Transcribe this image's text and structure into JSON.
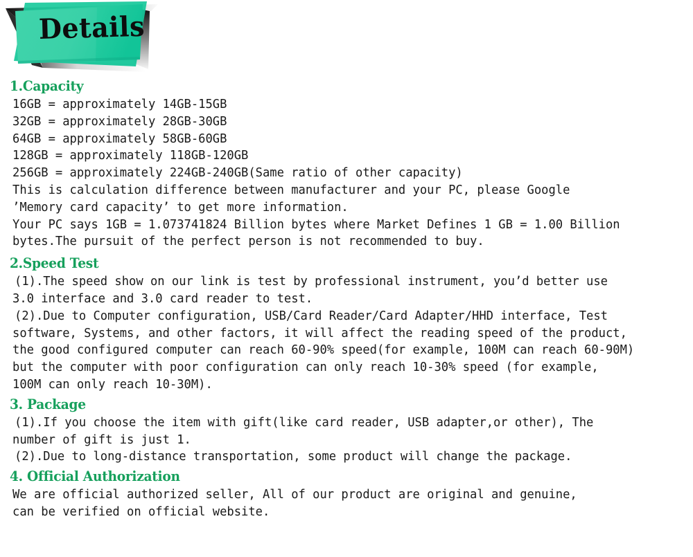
{
  "banner": {
    "title": "Details",
    "colors": {
      "accent_green": "#2ecfa4",
      "accent_green_dark": "#14c79b",
      "shadow_dark": "#111111",
      "title_color": "#0d0d0d"
    }
  },
  "theme": {
    "heading_green": "#16a05c",
    "body_text": "#1a1a1a",
    "background": "#ffffff"
  },
  "sections": [
    {
      "id": "capacity",
      "heading": "1.Capacity",
      "lines": [
        "16GB = approximately 14GB-15GB",
        "32GB = approximately 28GB-30GB",
        "64GB = approximately 58GB-60GB",
        "128GB = approximately 118GB-120GB",
        "256GB = approximately 224GB-240GB(Same ratio of other capacity)",
        "This is calculation difference between manufacturer and your PC, please Google",
        "’Memory card capacity’ to get more information.",
        "Your PC says 1GB = 1.073741824 Billion bytes where Market Defines 1 GB = 1.00 Billion",
        "bytes.The pursuit of the perfect person is not recommended to buy."
      ]
    },
    {
      "id": "speed-test",
      "heading": "2.Speed Test",
      "lines": [
        "(1).The speed show on our link is test by professional instrument, you’d better use",
        "3.0 interface and 3.0 card reader to test.",
        "(2).Due to Computer configuration, USB/Card Reader/Card Adapter/HHD interface, Test",
        "software, Systems, and other factors, it will affect the reading speed of the product,",
        "the good configured computer can reach 60-90% speed(for example, 100M can reach 60-90M)",
        "but the computer with poor configuration can only reach 10-30% speed (for example,",
        "100M can only reach 10-30M)."
      ]
    },
    {
      "id": "package",
      "heading": "3. Package",
      "lines": [
        "(1).If you choose the item with gift(like card reader, USB adapter,or other), The",
        "number of gift is just 1.",
        "(2).Due to long-distance transportation, some product will change the package."
      ]
    },
    {
      "id": "official-authorization",
      "heading": "4. Official Authorization",
      "lines": [
        "We are official authorized seller, All of our product are original and genuine,",
        "can be verified on official website."
      ]
    }
  ]
}
